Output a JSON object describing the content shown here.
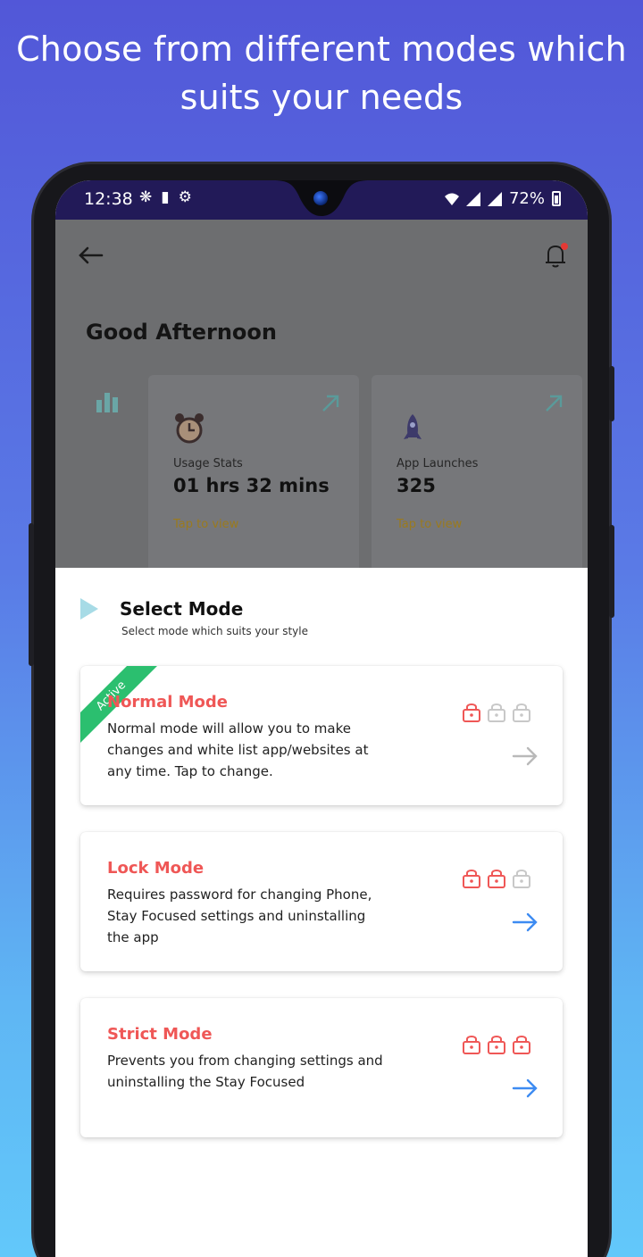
{
  "promo": {
    "headline_line1": "Choose from different modes which",
    "headline_line2": "suits your needs"
  },
  "status_bar": {
    "time": "12:38",
    "battery": "72%",
    "icons": [
      "slack-icon",
      "battery-saver-icon",
      "settings-icon"
    ]
  },
  "dashboard": {
    "greeting": "Good Afternoon",
    "cards": [
      {
        "label": "Usage Stats",
        "value": "01 hrs 32 mins",
        "link": "Tap to view",
        "icon": "alarm-clock-icon"
      },
      {
        "label": "App Launches",
        "value": "325",
        "link": "Tap to view",
        "icon": "rocket-icon"
      }
    ]
  },
  "sheet": {
    "title": "Select Mode",
    "subtitle": "Select mode which suits your style"
  },
  "modes": [
    {
      "title": "Normal Mode",
      "badge": "Active",
      "line1": "Normal mode will allow you to make",
      "line2": "changes and white list app/websites at",
      "line3": "any time. Tap to change.",
      "locks_on": 1
    },
    {
      "title": "Lock Mode",
      "line1": "Requires password for changing Phone,",
      "line2": "Stay Focused settings and uninstalling",
      "line3": "the app",
      "locks_on": 2
    },
    {
      "title": "Strict Mode",
      "line1": "Prevents you from changing settings and",
      "line2": "uninstalling the Stay Focused",
      "line3": "",
      "locks_on": 3
    }
  ],
  "colors": {
    "accent_red": "#ef5756",
    "active_green": "#2bbf6f",
    "arrow_blue": "#3d8bf2",
    "lock_off": "#c8c8c8",
    "status_bar": "#221a58"
  }
}
